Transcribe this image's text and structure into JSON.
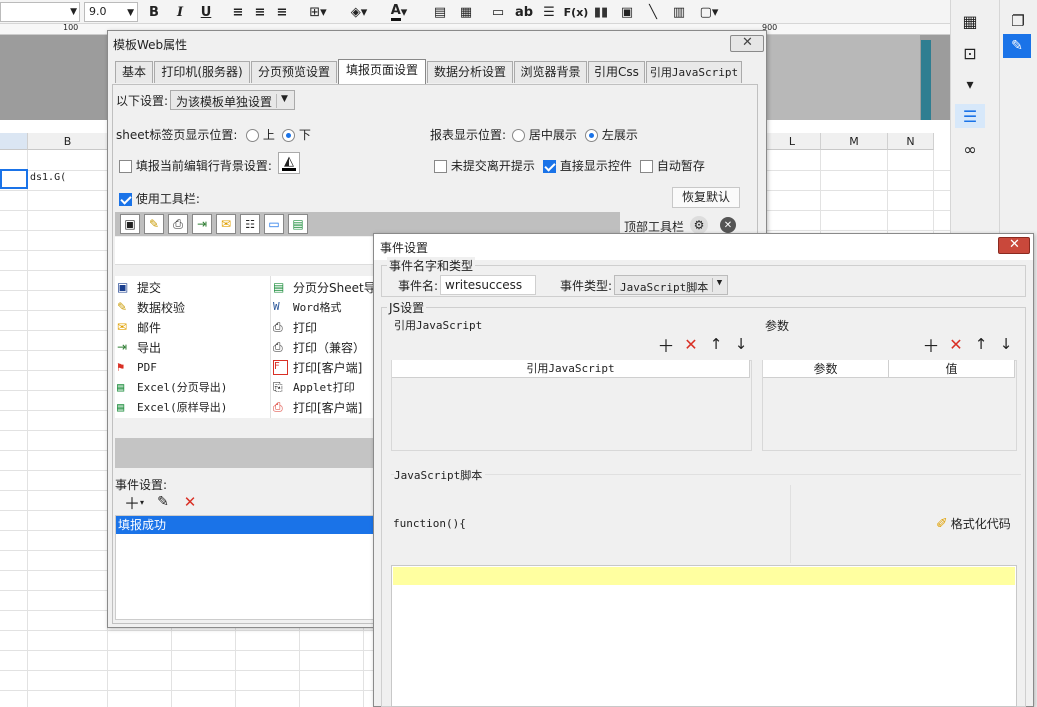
{
  "toolbar": {
    "font_size": "9.0",
    "bold": "B",
    "italic": "I",
    "underline": "U",
    "text_icon": "ab",
    "formula": "F(x)",
    "font_color_letter": "A"
  },
  "ruler": {
    "ticks": [
      "100",
      "900"
    ]
  },
  "sheet": {
    "col_b": "B",
    "col_l": "L",
    "col_m": "M",
    "col_n": "N",
    "cell_text": "ds1.G("
  },
  "web_dialog": {
    "title": "模板Web属性",
    "tabs": [
      "基本",
      "打印机(服务器)",
      "分页预览设置",
      "填报页面设置",
      "数据分析设置",
      "浏览器背景",
      "引用Css",
      "引用JavaScript"
    ],
    "active_tab": 3,
    "settings_label": "以下设置:",
    "settings_select": "为该模板单独设置",
    "sheet_pos_label": "sheet标签页显示位置:",
    "sheet_pos_top": "上",
    "sheet_pos_bottom": "下",
    "report_pos_label": "报表显示位置:",
    "report_pos_center": "居中展示",
    "report_pos_left": "左展示",
    "row_bg_label": "填报当前编辑行背景设置:",
    "unsubmitted_label": "未提交离开提示",
    "direct_show_label": "直接显示控件",
    "autosave_label": "自动暂存",
    "use_toolbar_label": "使用工具栏:",
    "restore_default": "恢复默认",
    "top_toolbar_label": "顶部工具栏",
    "items_left": [
      "提交",
      "数据校验",
      "邮件",
      "导出",
      "PDF",
      "Excel(分页导出)",
      "Excel(原样导出)"
    ],
    "items_right": [
      "分页分Sheet导出",
      "Word格式",
      "打印",
      "打印（兼容）",
      "打印[客户端]",
      "Applet打印",
      "打印[客户端]"
    ],
    "event_settings_label": "事件设置:",
    "event_item": "填报成功"
  },
  "event_dialog": {
    "title": "事件设置",
    "group_name_type": "事件名字和类型",
    "event_name_label": "事件名:",
    "event_name_value": "writesuccess",
    "event_type_label": "事件类型:",
    "event_type_value": "JavaScript脚本",
    "js_settings": "JS设置",
    "ref_js_label": "引用JavaScript",
    "params_label": "参数",
    "ref_js_header": "引用JavaScript",
    "param_col": "参数",
    "value_col": "值",
    "script_label": "JavaScript脚本",
    "code_line": "function(){",
    "format_code": "格式化代码"
  },
  "colors": {
    "accent": "#1a73e8",
    "delete_red": "#d93025",
    "selected_bg": "#1a73e8",
    "editor_line": "#ffffa0"
  }
}
